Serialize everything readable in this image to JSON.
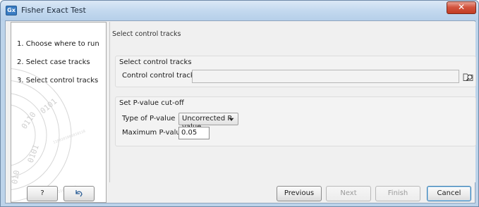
{
  "window": {
    "title": "Fisher Exact Test",
    "app_icon_text": "Gx",
    "close_glyph": "✕"
  },
  "steps": [
    {
      "label": "1.  Choose where to run"
    },
    {
      "label": "2.  Select case tracks"
    },
    {
      "label": "3.  Select control tracks",
      "active": true
    }
  ],
  "content": {
    "header": "Select control tracks",
    "control_group": {
      "title": "Select control tracks",
      "field_label": "Control control tracks",
      "field_value": "",
      "browse_icon": "folder-search-icon"
    },
    "pvalue_group": {
      "title": "Set P-value cut-off",
      "type_label": "Type of P-value",
      "type_selected": "Uncorrected P-value",
      "max_label": "Maximum P-value",
      "max_value": "0.05"
    }
  },
  "buttons": {
    "help": "?",
    "reset_icon": "reset-arrow-icon",
    "previous": "Previous",
    "next": "Next",
    "finish": "Finish",
    "cancel": "Cancel"
  },
  "colors": {
    "title_bar": "#c4d9ef",
    "close_button": "#c23b22",
    "default_button_border": "#3c7fb1"
  }
}
